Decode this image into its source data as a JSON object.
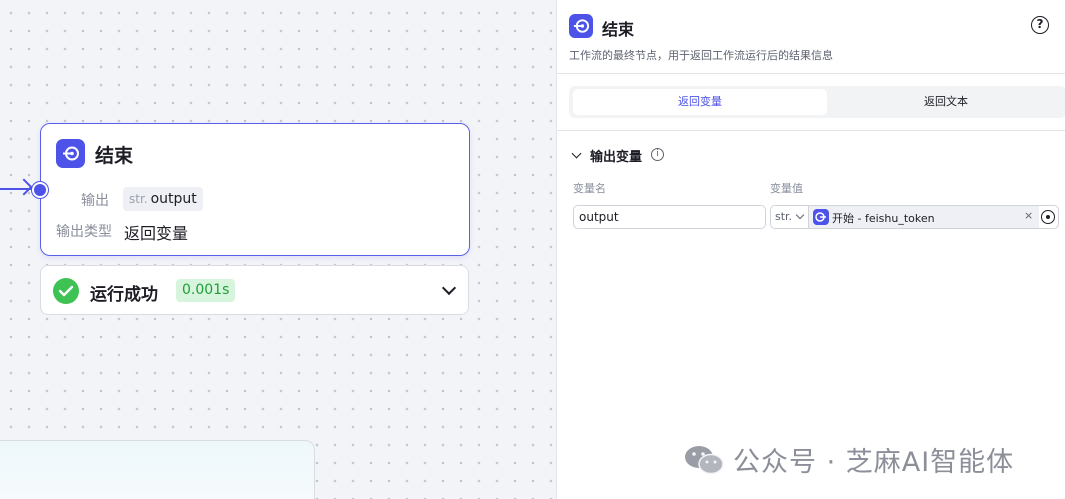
{
  "canvas": {
    "node": {
      "title": "结束",
      "output_label": "输出",
      "output_type": "str.",
      "output_name": "output",
      "output_kind_label": "输出类型",
      "output_kind_value": "返回变量"
    },
    "status": {
      "text": "运行成功",
      "time": "0.001s"
    }
  },
  "panel": {
    "title": "结束",
    "description": "工作流的最终节点，用于返回工作流运行后的结果信息",
    "tabs": [
      {
        "label": "返回变量",
        "active": true
      },
      {
        "label": "返回文本",
        "active": false
      }
    ],
    "section_title": "输出变量",
    "columns": {
      "name": "变量名",
      "value": "变量值"
    },
    "row": {
      "name": "output",
      "type": "str.",
      "ref_node": "开始",
      "ref_separator": "-",
      "ref_var": "feishu_token",
      "clear": "×"
    }
  },
  "watermark": {
    "text": "公众号 · 芝麻AI智能体"
  },
  "colors": {
    "accent": "#4d53e8",
    "success": "#3ec254",
    "success_badge_bg": "#d7f5dc"
  }
}
